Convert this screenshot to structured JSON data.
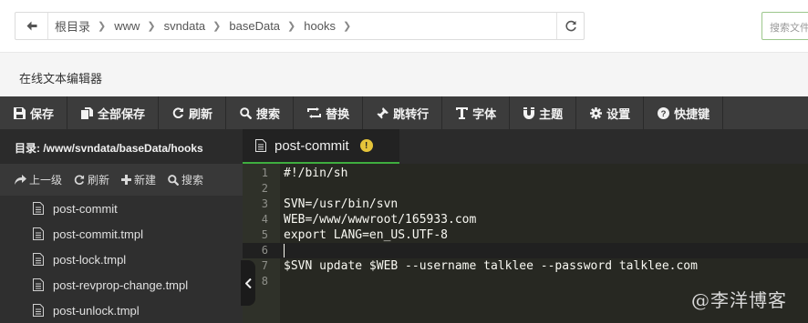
{
  "path_bar": {
    "crumbs": [
      "根目录",
      "www",
      "svndata",
      "baseData",
      "hooks"
    ],
    "search_placeholder": "搜索文件"
  },
  "editor_title": "在线文本编辑器",
  "toolbar": {
    "save": "保存",
    "save_all": "全部保存",
    "refresh": "刷新",
    "search": "搜索",
    "replace": "替换",
    "goto_line": "跳转行",
    "font": "字体",
    "theme": "主题",
    "settings": "设置",
    "shortcuts": "快捷键"
  },
  "sidebar": {
    "dir_label": "目录: /www/svndata/baseData/hooks",
    "actions": {
      "up": "上一级",
      "refresh": "刷新",
      "new": "新建",
      "search": "搜索"
    },
    "files": [
      "post-commit",
      "post-commit.tmpl",
      "post-lock.tmpl",
      "post-revprop-change.tmpl",
      "post-unlock.tmpl"
    ]
  },
  "tab": {
    "filename": "post-commit",
    "warning_mark": "!"
  },
  "code": {
    "active_line": 6,
    "lines": [
      {
        "n": "1",
        "text": "#!/bin/sh"
      },
      {
        "n": "2",
        "text": ""
      },
      {
        "n": "3",
        "text": "SVN=/usr/bin/svn"
      },
      {
        "n": "4",
        "text": "WEB=/www/wwwroot/165933.com"
      },
      {
        "n": "5",
        "text": "export LANG=en_US.UTF-8"
      },
      {
        "n": "6",
        "text": ""
      },
      {
        "n": "7",
        "text": "$SVN update $WEB --username talklee --password talklee.com"
      },
      {
        "n": "8",
        "text": ""
      }
    ]
  },
  "watermark": "@李洋博客",
  "colors": {
    "toolbar_bg": "#3c3c3c",
    "editor_bg": "#272822",
    "tab_underline": "#3fae3f",
    "warning": "#e5c43a"
  }
}
